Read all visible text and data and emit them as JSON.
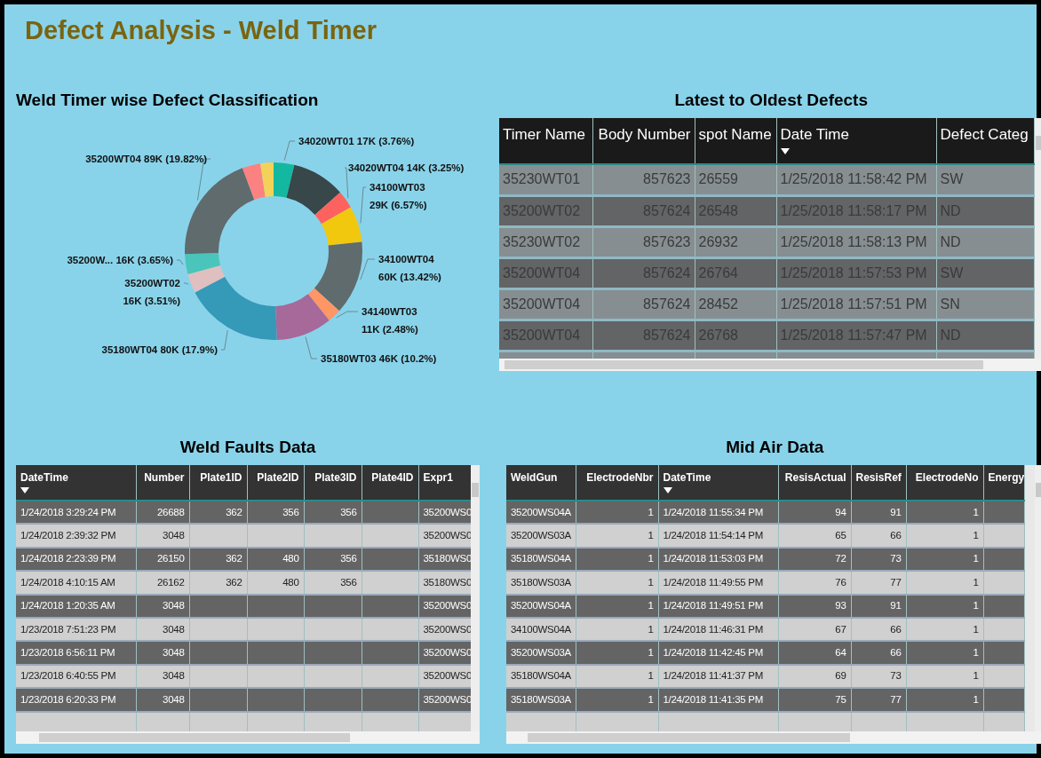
{
  "title": "Defect Analysis - Weld Timer",
  "defect_chart": {
    "title": "Weld Timer wise Defect Classification",
    "chart_data": {
      "type": "donut",
      "categories": [
        "34020WT01",
        null,
        "34020WT04",
        "34100WT03",
        "34100WT04",
        "34140WT03",
        "35180WT03",
        "35180WT04",
        "35200WT02",
        "35200W...",
        "35200WT04",
        null,
        null
      ],
      "values": [
        3.76,
        9.74,
        3.25,
        6.57,
        13.42,
        2.48,
        10.2,
        17.9,
        3.51,
        3.65,
        19.82,
        3.3,
        2.4
      ],
      "colors": [
        "#14b8a0",
        "#37474a",
        "#fd625e",
        "#f2c80f",
        "#5f6b6d",
        "#fe9666",
        "#a66999",
        "#3599b8",
        "#dfbfbf",
        "#4ac5bb",
        "#5f6b6d",
        "#fb8281",
        "#f4d25a"
      ],
      "value_labels": [
        "17K (3.76%)",
        null,
        "14K (3.25%)",
        "29K (6.57%)",
        "60K (13.42%)",
        "11K (2.48%)",
        "46K (10.2%)",
        "80K (17.9%)",
        "16K (3.51%)",
        "16K (3.65%)",
        "89K (19.82%)",
        null,
        null
      ]
    }
  },
  "latest_defects": {
    "title": "Latest to Oldest Defects",
    "columns": [
      {
        "label": "Timer Name",
        "kind": "text",
        "sorted": false
      },
      {
        "label": "Body Number",
        "kind": "number",
        "sorted": false
      },
      {
        "label": "spot Name",
        "kind": "text",
        "sorted": false
      },
      {
        "label": "Date Time",
        "kind": "text",
        "sorted": true
      },
      {
        "label": "Defect Categ",
        "kind": "text",
        "sorted": false
      }
    ],
    "rows": [
      [
        "35230WT01",
        "857623",
        "26559",
        "1/25/2018 11:58:42 PM",
        "SW"
      ],
      [
        "35200WT02",
        "857624",
        "26548",
        "1/25/2018 11:58:17 PM",
        "ND"
      ],
      [
        "35230WT02",
        "857623",
        "26932",
        "1/25/2018 11:58:13 PM",
        "ND"
      ],
      [
        "35200WT04",
        "857624",
        "26764",
        "1/25/2018 11:57:53 PM",
        "SW"
      ],
      [
        "35200WT04",
        "857624",
        "28452",
        "1/25/2018 11:57:51 PM",
        "SN"
      ],
      [
        "35200WT04",
        "857624",
        "26768",
        "1/25/2018 11:57:47 PM",
        "ND"
      ]
    ]
  },
  "weld_faults": {
    "title": "Weld Faults Data",
    "columns": [
      {
        "label": "DateTime",
        "kind": "text",
        "sorted": true
      },
      {
        "label": "Number",
        "kind": "number",
        "sorted": false
      },
      {
        "label": "Plate1ID",
        "kind": "number",
        "sorted": false
      },
      {
        "label": "Plate2ID",
        "kind": "number",
        "sorted": false
      },
      {
        "label": "Plate3ID",
        "kind": "number",
        "sorted": false
      },
      {
        "label": "Plate4ID",
        "kind": "number",
        "sorted": false
      },
      {
        "label": "Expr1",
        "kind": "text",
        "sorted": false
      }
    ],
    "rows": [
      [
        "1/24/2018 3:29:24 PM",
        "26688",
        "362",
        "356",
        "356",
        null,
        "35200WS0"
      ],
      [
        "1/24/2018 2:39:32 PM",
        "3048",
        null,
        null,
        null,
        null,
        "35200WS0"
      ],
      [
        "1/24/2018 2:23:39 PM",
        "26150",
        "362",
        "480",
        "356",
        null,
        "35180WS0"
      ],
      [
        "1/24/2018 4:10:15 AM",
        "26162",
        "362",
        "480",
        "356",
        null,
        "35180WS0"
      ],
      [
        "1/24/2018 1:20:35 AM",
        "3048",
        null,
        null,
        null,
        null,
        "35200WS0"
      ],
      [
        "1/23/2018 7:51:23 PM",
        "3048",
        null,
        null,
        null,
        null,
        "35200WS0"
      ],
      [
        "1/23/2018 6:56:11 PM",
        "3048",
        null,
        null,
        null,
        null,
        "35200WS0"
      ],
      [
        "1/23/2018 6:40:55 PM",
        "3048",
        null,
        null,
        null,
        null,
        "35200WS0"
      ],
      [
        "1/23/2018 6:20:33 PM",
        "3048",
        null,
        null,
        null,
        null,
        "35200WS0"
      ]
    ]
  },
  "mid_air": {
    "title": "Mid Air Data",
    "columns": [
      {
        "label": "WeldGun",
        "kind": "text",
        "sorted": false
      },
      {
        "label": "ElectrodeNbr",
        "kind": "number",
        "sorted": false
      },
      {
        "label": "DateTime",
        "kind": "text",
        "sorted": true
      },
      {
        "label": "ResisActual",
        "kind": "number",
        "sorted": false
      },
      {
        "label": "ResisRef",
        "kind": "number",
        "sorted": false
      },
      {
        "label": "ElectrodeNo",
        "kind": "number",
        "sorted": false
      },
      {
        "label": "Energy",
        "kind": "number",
        "sorted": false
      }
    ],
    "rows": [
      [
        "35200WS04A",
        "1",
        "1/24/2018 11:55:34 PM",
        "94",
        "91",
        "1",
        null
      ],
      [
        "35200WS03A",
        "1",
        "1/24/2018 11:54:14 PM",
        "65",
        "66",
        "1",
        null
      ],
      [
        "35180WS04A",
        "1",
        "1/24/2018 11:53:03 PM",
        "72",
        "73",
        "1",
        null
      ],
      [
        "35180WS03A",
        "1",
        "1/24/2018 11:49:55 PM",
        "76",
        "77",
        "1",
        null
      ],
      [
        "35200WS04A",
        "1",
        "1/24/2018 11:49:51 PM",
        "93",
        "91",
        "1",
        null
      ],
      [
        "34100WS04A",
        "1",
        "1/24/2018 11:46:31 PM",
        "67",
        "66",
        "1",
        null
      ],
      [
        "35200WS03A",
        "1",
        "1/24/2018 11:42:45 PM",
        "64",
        "66",
        "1",
        null
      ],
      [
        "35180WS04A",
        "1",
        "1/24/2018 11:41:37 PM",
        "69",
        "73",
        "1",
        null
      ],
      [
        "35180WS03A",
        "1",
        "1/24/2018 11:41:35 PM",
        "75",
        "77",
        "1",
        null
      ]
    ]
  }
}
